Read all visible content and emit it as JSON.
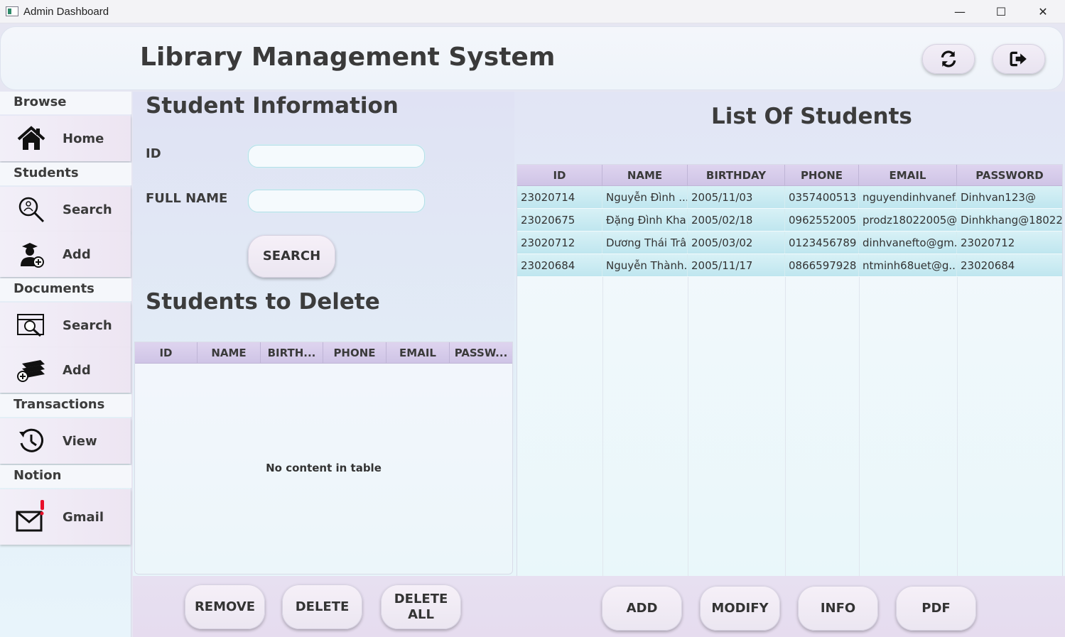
{
  "window": {
    "title": "Admin Dashboard",
    "controls": {
      "minimize": "—",
      "maximize": "☐",
      "close": "✕"
    }
  },
  "header": {
    "title": "Library Management System",
    "buttons": [
      {
        "icon": "refresh-icon"
      },
      {
        "icon": "logout-icon"
      }
    ]
  },
  "sidebar": {
    "sections": [
      {
        "label": "Browse",
        "items": [
          {
            "label": "Home",
            "icon": "home-icon"
          }
        ]
      },
      {
        "label": "Students",
        "items": [
          {
            "label": "Search",
            "icon": "search-student-icon"
          },
          {
            "label": "Add",
            "icon": "add-student-icon"
          }
        ]
      },
      {
        "label": "Documents",
        "items": [
          {
            "label": "Search",
            "icon": "search-document-icon"
          },
          {
            "label": "Add",
            "icon": "add-document-icon"
          }
        ]
      },
      {
        "label": "Transactions",
        "items": [
          {
            "label": "View",
            "icon": "history-icon"
          }
        ]
      },
      {
        "label": "Notion",
        "items": [
          {
            "label": "Gmail",
            "icon": "mail-alert-icon"
          }
        ]
      }
    ]
  },
  "student_info": {
    "title": "Student Information",
    "id_label": "ID",
    "id_value": "",
    "name_label": "FULL NAME",
    "name_value": "",
    "search_button": "SEARCH"
  },
  "delete_section": {
    "title": "Students to Delete",
    "columns": [
      "ID",
      "NAME",
      "BIRTH...",
      "PHONE",
      "EMAIL",
      "PASSW..."
    ],
    "empty_message": "No content in table",
    "buttons": {
      "remove": "REMOVE",
      "delete": "DELETE",
      "delete_all_line1": "DELETE",
      "delete_all_line2": "ALL"
    }
  },
  "students_list": {
    "title": "List Of Students",
    "columns": [
      "ID",
      "NAME",
      "BIRTHDAY",
      "PHONE",
      "EMAIL",
      "PASSWORD"
    ],
    "rows": [
      [
        "23020714",
        "Nguyễn Đình ...",
        "2005/11/03",
        "0357400513",
        "nguyendinhvanef...",
        "Dinhvan123@"
      ],
      [
        "23020675",
        "Đặng Đình Kha...",
        "2005/02/18",
        "0962552005",
        "prodz18022005@...",
        "Dinhkhang@18022..."
      ],
      [
        "23020712",
        "Dương Thái Trân",
        "2005/03/02",
        "0123456789",
        "dinhvanefto@gm...",
        "23020712"
      ],
      [
        "23020684",
        "Nguyễn Thành...",
        "2005/11/17",
        "0866597928",
        "ntminh68uet@g...",
        "23020684"
      ]
    ],
    "buttons": {
      "add": "ADD",
      "modify": "MODIFY",
      "info": "INFO",
      "pdf": "PDF"
    }
  }
}
